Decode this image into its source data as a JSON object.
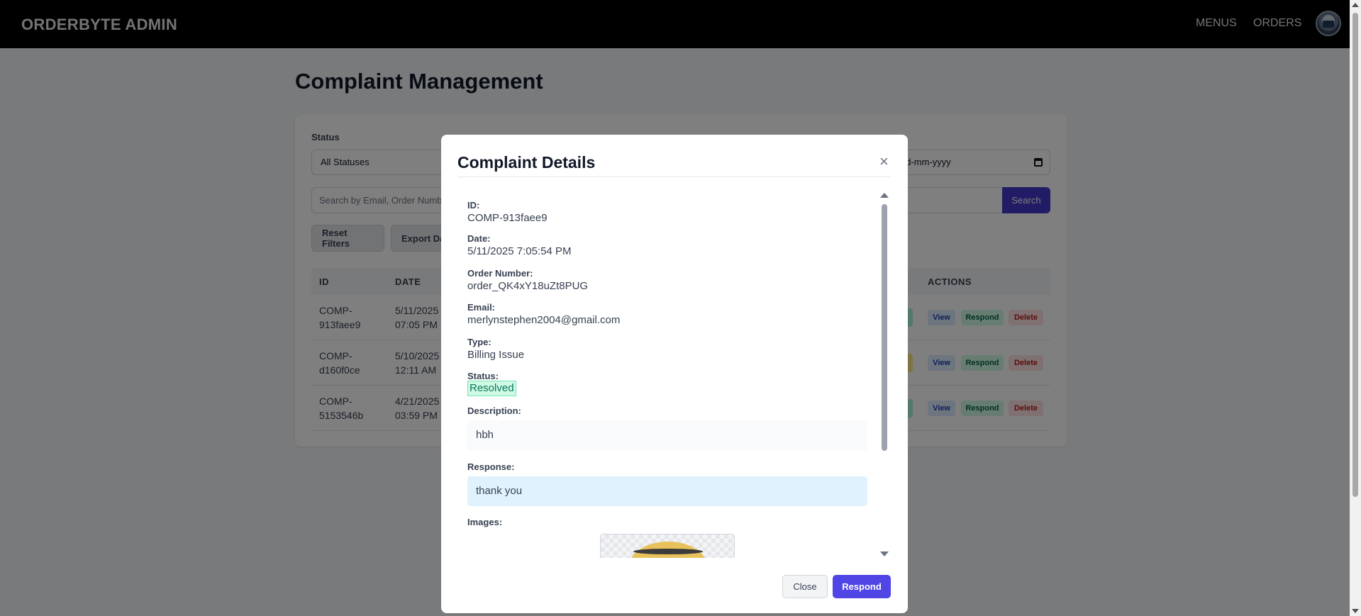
{
  "navbar": {
    "brand": "ORDERBYTE ADMIN",
    "links": [
      "MENUS",
      "ORDERS"
    ],
    "avatar_icon": "user-avatar"
  },
  "page": {
    "title": "Complaint Management"
  },
  "filters": {
    "status_label": "Status",
    "status_value": "All Statuses",
    "date_to_value": "dd-mm-yyyy",
    "search_placeholder": "Search by Email, Order Number",
    "search_button": "Search",
    "reset_button": "Reset Filters",
    "export_button": "Export Da"
  },
  "table": {
    "headers": {
      "id": "ID",
      "date": "DATE",
      "actions": "ACTIONS"
    },
    "rows": [
      {
        "id_line1": "COMP-",
        "id_line2": "913faee9",
        "date_line1": "5/11/2025",
        "date_line2": "07:05 PM",
        "status_color": "#a7f3d0"
      },
      {
        "id_line1": "COMP-",
        "id_line2": "d160f0ce",
        "date_line1": "5/10/2025",
        "date_line2": "12:11 AM",
        "status_color": "#fde68a"
      },
      {
        "id_line1": "COMP-",
        "id_line2": "5153546b",
        "date_line1": "4/21/2025",
        "date_line2": "03:59 PM",
        "status_color": "#a7f3d0"
      }
    ],
    "actions": {
      "view": "View",
      "respond": "Respond",
      "delete": "Delete"
    }
  },
  "modal": {
    "title": "Complaint Details",
    "close_icon": "×",
    "fields": {
      "id_label": "ID:",
      "id_value": "COMP-913faee9",
      "date_label": "Date:",
      "date_value": "5/11/2025 7:05:54 PM",
      "order_label": "Order Number:",
      "order_value": "order_QK4xY18uZt8PUG",
      "email_label": "Email:",
      "email_value": "merlynstephen2004@gmail.com",
      "type_label": "Type:",
      "type_value": "Billing Issue",
      "status_label": "Status:",
      "status_value": "Resolved",
      "description_label": "Description:",
      "description_value": "hbh",
      "response_label": "Response:",
      "response_value": "thank you",
      "images_label": "Images:"
    },
    "close_button": "Close",
    "respond_button": "Respond"
  },
  "colors": {
    "accent": "#4338ca",
    "navbar": "#000000",
    "resolved": "#d1fae5"
  }
}
